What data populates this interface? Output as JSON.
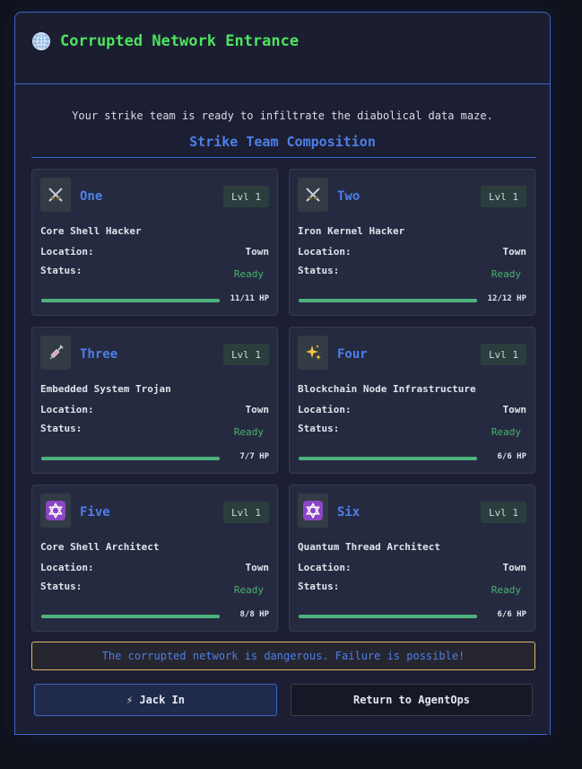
{
  "header": {
    "title": "Corrupted Network Entrance",
    "icon": "globe-icon"
  },
  "intro": "Your strike team is ready to infiltrate the diabolical data maze.",
  "team_title": "Strike Team Composition",
  "labels": {
    "location": "Location:",
    "status": "Status:"
  },
  "members": [
    {
      "name": "One",
      "icon": "crossed-swords-icon",
      "level": "Lvl 1",
      "class": "Core Shell Hacker",
      "location": "Town",
      "status": "Ready",
      "hp": "11/11 HP",
      "hp_fraction": 1.0
    },
    {
      "name": "Two",
      "icon": "crossed-swords-icon",
      "level": "Lvl 1",
      "class": "Iron Kernel Hacker",
      "location": "Town",
      "status": "Ready",
      "hp": "12/12 HP",
      "hp_fraction": 1.0
    },
    {
      "name": "Three",
      "icon": "syringe-icon",
      "level": "Lvl 1",
      "class": "Embedded System Trojan",
      "location": "Town",
      "status": "Ready",
      "hp": "7/7 HP",
      "hp_fraction": 1.0
    },
    {
      "name": "Four",
      "icon": "sparkles-icon",
      "level": "Lvl 1",
      "class": "Blockchain Node Infrastructure",
      "location": "Town",
      "status": "Ready",
      "hp": "6/6 HP",
      "hp_fraction": 1.0
    },
    {
      "name": "Five",
      "icon": "star-of-david-icon",
      "level": "Lvl 1",
      "class": "Core Shell Architect",
      "location": "Town",
      "status": "Ready",
      "hp": "8/8 HP",
      "hp_fraction": 1.0
    },
    {
      "name": "Six",
      "icon": "star-of-david-icon",
      "level": "Lvl 1",
      "class": "Quantum Thread Architect",
      "location": "Town",
      "status": "Ready",
      "hp": "6/6 HP",
      "hp_fraction": 1.0
    }
  ],
  "warning": "The corrupted network is dangerous. Failure is possible!",
  "buttons": {
    "jack_in": "⚡ Jack In",
    "return": "Return to AgentOps"
  },
  "colors": {
    "accent": "#4d7fe9",
    "title_green": "#4ee35f",
    "ready_green": "#46b26f",
    "warning_border": "#d8ba68"
  }
}
